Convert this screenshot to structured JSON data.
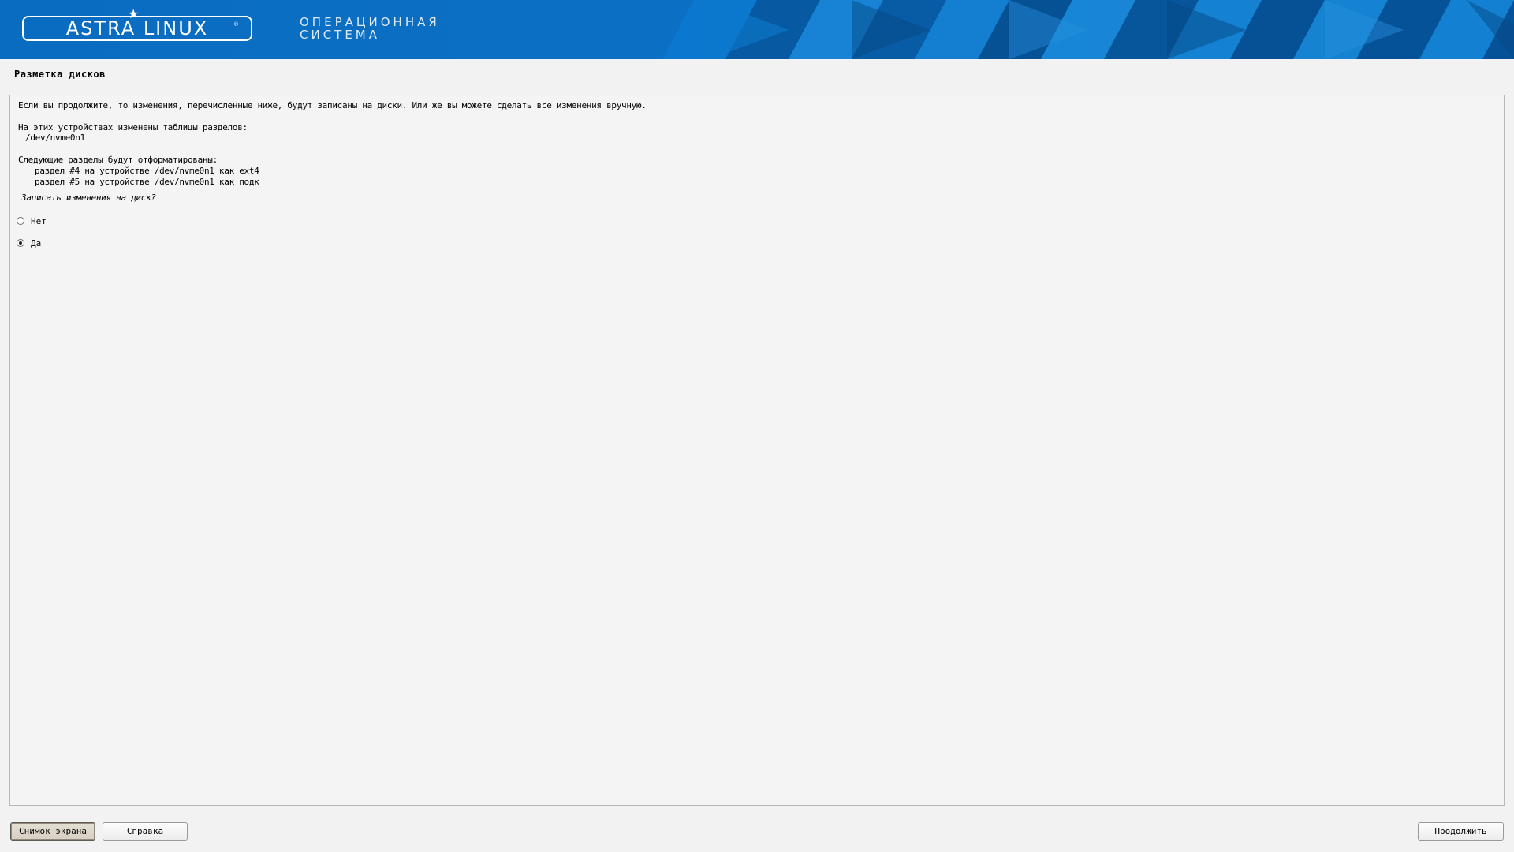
{
  "header": {
    "logo_text": "ASTRA LINUX",
    "logo_mark": "®",
    "subtitle_line1": "ОПЕРАЦИОННАЯ",
    "subtitle_line2": "СИСТЕМА",
    "colors": {
      "banner_blue": "#0a6cc0",
      "banner_dark": "#07559a",
      "banner_light": "#1f86d6"
    }
  },
  "page": {
    "title": "Разметка дисков"
  },
  "panel": {
    "intro": "Если вы продолжите, то изменения, перечисленные ниже, будут записаны на диски. Или же вы можете сделать все изменения вручную.",
    "tables_header": "На этих устройствах изменены таблицы разделов:",
    "tables_device": "/dev/nvme0n1",
    "format_header": "Следующие разделы будут отформатированы:",
    "format_item_1": "раздел #4 на устройстве /dev/nvme0n1 как ext4",
    "format_item_2": "раздел #5 на устройстве /dev/nvme0n1 как подк",
    "question": "Записать изменения на диск?",
    "options": [
      {
        "label": "Нет",
        "selected": false
      },
      {
        "label": "Да",
        "selected": true
      }
    ]
  },
  "buttons": {
    "screenshot": "Снимок экрана",
    "help": "Справка",
    "continue": "Продолжить"
  }
}
